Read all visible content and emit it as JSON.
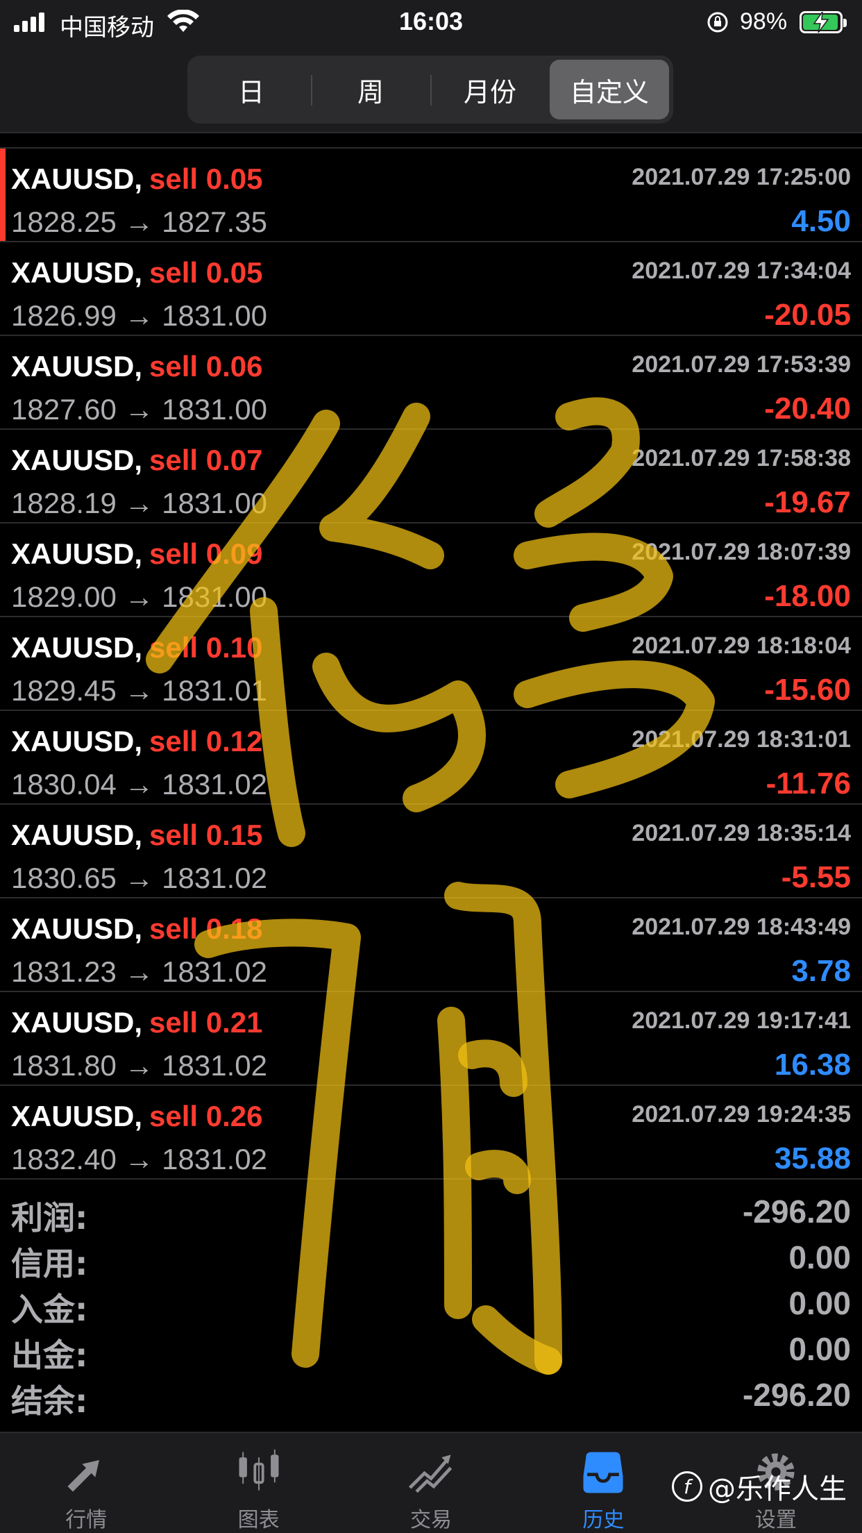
{
  "status_bar": {
    "carrier": "中国移动",
    "time": "16:03",
    "battery_percent": "98%"
  },
  "segments": [
    {
      "label": "日",
      "active": false
    },
    {
      "label": "周",
      "active": false
    },
    {
      "label": "月份",
      "active": false
    },
    {
      "label": "自定义",
      "active": true
    }
  ],
  "trades": [
    {
      "symbol": "XAUUSD,",
      "side": "sell 0.05",
      "time": "2021.07.29 17:25:00",
      "prices": "1828.25 → 1827.35",
      "profit": "4.50",
      "sign": "pos",
      "selected": true
    },
    {
      "symbol": "XAUUSD,",
      "side": "sell 0.05",
      "time": "2021.07.29 17:34:04",
      "prices": "1826.99 → 1831.00",
      "profit": "-20.05",
      "sign": "neg"
    },
    {
      "symbol": "XAUUSD,",
      "side": "sell 0.06",
      "time": "2021.07.29 17:53:39",
      "prices": "1827.60 → 1831.00",
      "profit": "-20.40",
      "sign": "neg"
    },
    {
      "symbol": "XAUUSD,",
      "side": "sell 0.07",
      "time": "2021.07.29 17:58:38",
      "prices": "1828.19 → 1831.00",
      "profit": "-19.67",
      "sign": "neg"
    },
    {
      "symbol": "XAUUSD,",
      "side": "sell 0.09",
      "time": "2021.07.29 18:07:39",
      "prices": "1829.00 → 1831.00",
      "profit": "-18.00",
      "sign": "neg"
    },
    {
      "symbol": "XAUUSD,",
      "side": "sell 0.10",
      "time": "2021.07.29 18:18:04",
      "prices": "1829.45 → 1831.01",
      "profit": "-15.60",
      "sign": "neg"
    },
    {
      "symbol": "XAUUSD,",
      "side": "sell 0.12",
      "time": "2021.07.29 18:31:01",
      "prices": "1830.04 → 1831.02",
      "profit": "-11.76",
      "sign": "neg"
    },
    {
      "symbol": "XAUUSD,",
      "side": "sell 0.15",
      "time": "2021.07.29 18:35:14",
      "prices": "1830.65 → 1831.02",
      "profit": "-5.55",
      "sign": "neg"
    },
    {
      "symbol": "XAUUSD,",
      "side": "sell 0.18",
      "time": "2021.07.29 18:43:49",
      "prices": "1831.23 → 1831.02",
      "profit": "3.78",
      "sign": "pos"
    },
    {
      "symbol": "XAUUSD,",
      "side": "sell 0.21",
      "time": "2021.07.29 19:17:41",
      "prices": "1831.80 → 1831.02",
      "profit": "16.38",
      "sign": "pos"
    },
    {
      "symbol": "XAUUSD,",
      "side": "sell 0.26",
      "time": "2021.07.29 19:24:35",
      "prices": "1832.40 → 1831.02",
      "profit": "35.88",
      "sign": "pos"
    }
  ],
  "summary": [
    {
      "label": "利润:",
      "value": "-296.20"
    },
    {
      "label": "信用:",
      "value": "0.00"
    },
    {
      "label": "入金:",
      "value": "0.00"
    },
    {
      "label": "出金:",
      "value": "0.00"
    },
    {
      "label": "结余:",
      "value": "-296.20"
    }
  ],
  "tabs": [
    {
      "label": "行情",
      "icon": "quotes-icon",
      "active": false
    },
    {
      "label": "图表",
      "icon": "chart-icon",
      "active": false
    },
    {
      "label": "交易",
      "icon": "trade-icon",
      "active": false
    },
    {
      "label": "历史",
      "icon": "history-icon",
      "active": true
    },
    {
      "label": "设置",
      "icon": "settings-icon",
      "active": false
    }
  ],
  "watermark": "@乐作人生",
  "colors": {
    "profit_positive": "#2f8cff",
    "profit_negative": "#ff3b30",
    "sell": "#ff3b30",
    "active_tab": "#2f8cff",
    "overlay_ink": "#f2c014"
  }
}
